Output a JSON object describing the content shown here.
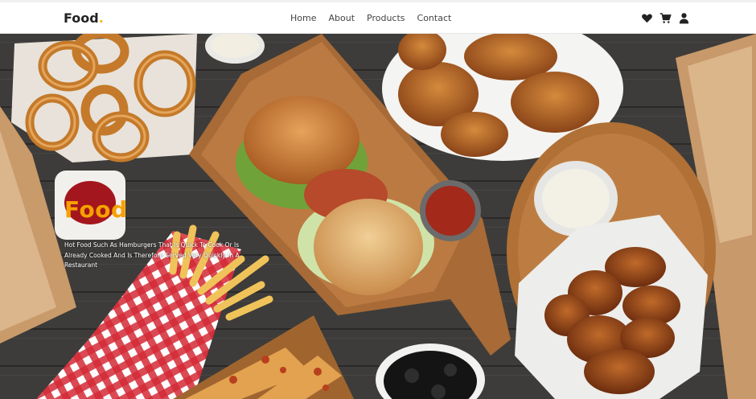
{
  "brand": {
    "name": "Food",
    "dot": ".",
    "accent_color": "#f5b800"
  },
  "nav": {
    "links": [
      "Home",
      "About",
      "Products",
      "Contact"
    ],
    "icons": [
      "heart-icon",
      "cart-icon",
      "user-icon"
    ]
  },
  "hero": {
    "title": "Food",
    "title_color": "#f5a100",
    "description": "Hot Food Such As Hamburgers That Is Quick To Cook Or Is Already Cooked And Is Therefore Served Very Quickly In A Restaurant"
  }
}
